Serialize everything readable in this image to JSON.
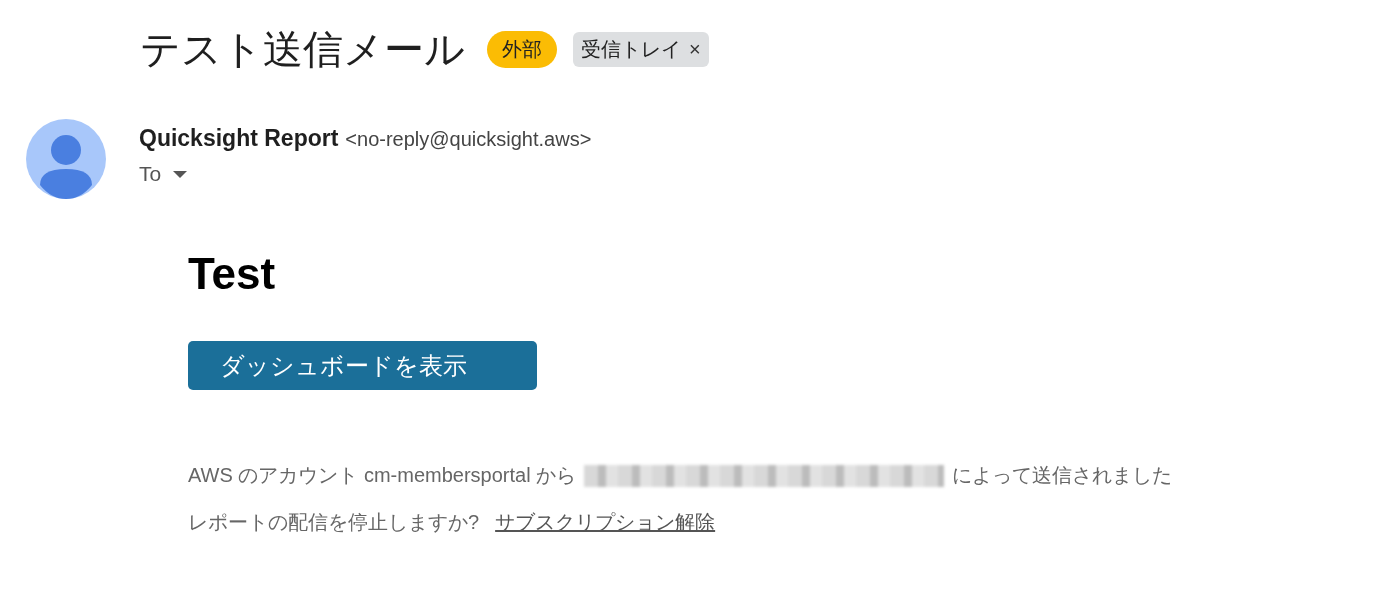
{
  "subject": "テスト送信メール",
  "labels": [
    {
      "text": "外部",
      "kind": "category",
      "color": "#fbbc04"
    },
    {
      "text": "受信トレイ",
      "kind": "folder",
      "color": "#dddfe1",
      "remove": "×"
    }
  ],
  "sender": {
    "name": "Quicksight Report",
    "address": "<no-reply@quicksight.aws>",
    "recipient_label": "To"
  },
  "body": {
    "heading": "Test",
    "button": "ダッシュボードを表示",
    "footer": [
      {
        "parts": [
          {
            "kind": "text",
            "text": "AWS のアカウント cm-membersportal から"
          },
          {
            "kind": "redacted"
          },
          {
            "kind": "text",
            "text": "によって送信されました"
          }
        ]
      },
      {
        "parts": [
          {
            "kind": "text",
            "text": "レポートの配信を停止しますか?"
          },
          {
            "kind": "link",
            "text": "サブスクリプション解除"
          }
        ]
      }
    ]
  }
}
